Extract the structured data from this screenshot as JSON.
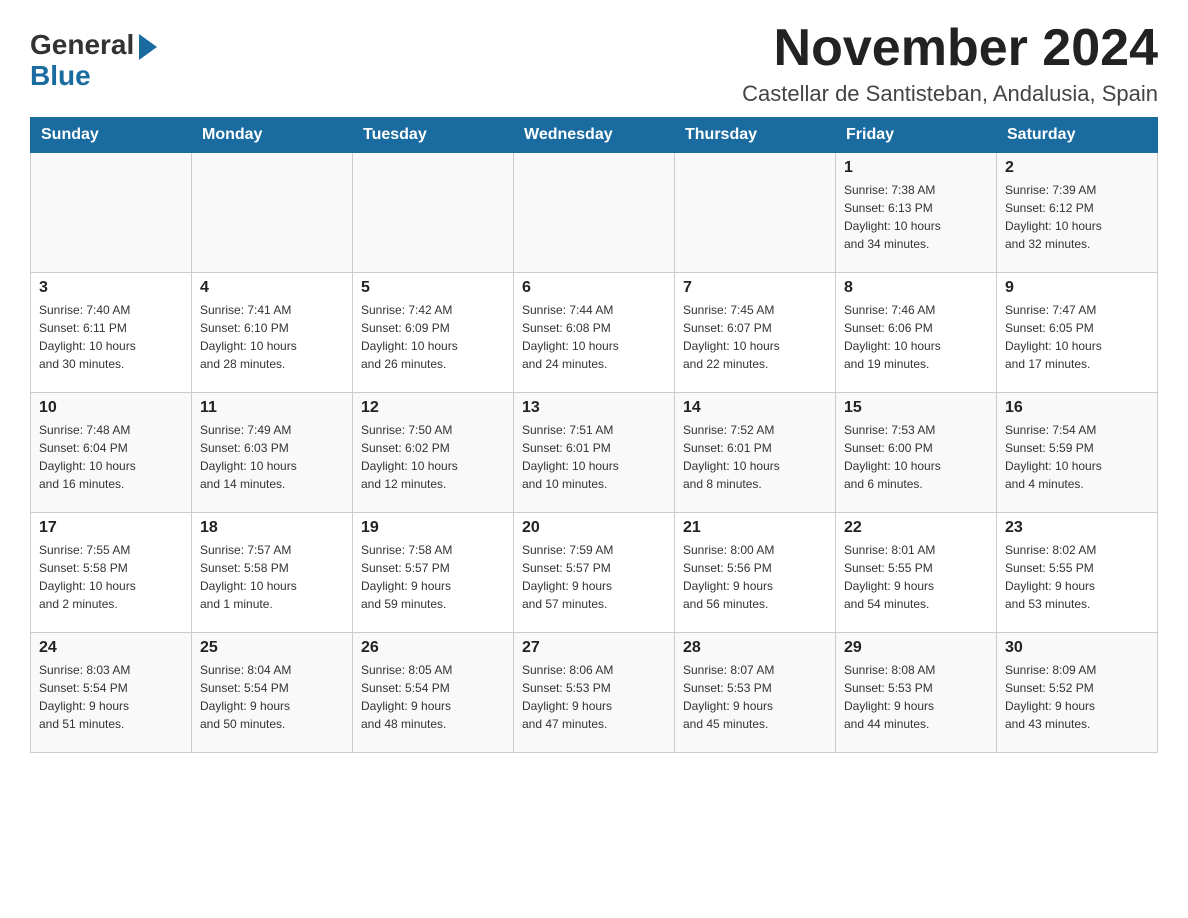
{
  "logo": {
    "general": "General",
    "blue": "Blue"
  },
  "header": {
    "month_year": "November 2024",
    "location": "Castellar de Santisteban, Andalusia, Spain"
  },
  "days_of_week": [
    "Sunday",
    "Monday",
    "Tuesday",
    "Wednesday",
    "Thursday",
    "Friday",
    "Saturday"
  ],
  "weeks": [
    [
      {
        "day": "",
        "info": ""
      },
      {
        "day": "",
        "info": ""
      },
      {
        "day": "",
        "info": ""
      },
      {
        "day": "",
        "info": ""
      },
      {
        "day": "",
        "info": ""
      },
      {
        "day": "1",
        "info": "Sunrise: 7:38 AM\nSunset: 6:13 PM\nDaylight: 10 hours\nand 34 minutes."
      },
      {
        "day": "2",
        "info": "Sunrise: 7:39 AM\nSunset: 6:12 PM\nDaylight: 10 hours\nand 32 minutes."
      }
    ],
    [
      {
        "day": "3",
        "info": "Sunrise: 7:40 AM\nSunset: 6:11 PM\nDaylight: 10 hours\nand 30 minutes."
      },
      {
        "day": "4",
        "info": "Sunrise: 7:41 AM\nSunset: 6:10 PM\nDaylight: 10 hours\nand 28 minutes."
      },
      {
        "day": "5",
        "info": "Sunrise: 7:42 AM\nSunset: 6:09 PM\nDaylight: 10 hours\nand 26 minutes."
      },
      {
        "day": "6",
        "info": "Sunrise: 7:44 AM\nSunset: 6:08 PM\nDaylight: 10 hours\nand 24 minutes."
      },
      {
        "day": "7",
        "info": "Sunrise: 7:45 AM\nSunset: 6:07 PM\nDaylight: 10 hours\nand 22 minutes."
      },
      {
        "day": "8",
        "info": "Sunrise: 7:46 AM\nSunset: 6:06 PM\nDaylight: 10 hours\nand 19 minutes."
      },
      {
        "day": "9",
        "info": "Sunrise: 7:47 AM\nSunset: 6:05 PM\nDaylight: 10 hours\nand 17 minutes."
      }
    ],
    [
      {
        "day": "10",
        "info": "Sunrise: 7:48 AM\nSunset: 6:04 PM\nDaylight: 10 hours\nand 16 minutes."
      },
      {
        "day": "11",
        "info": "Sunrise: 7:49 AM\nSunset: 6:03 PM\nDaylight: 10 hours\nand 14 minutes."
      },
      {
        "day": "12",
        "info": "Sunrise: 7:50 AM\nSunset: 6:02 PM\nDaylight: 10 hours\nand 12 minutes."
      },
      {
        "day": "13",
        "info": "Sunrise: 7:51 AM\nSunset: 6:01 PM\nDaylight: 10 hours\nand 10 minutes."
      },
      {
        "day": "14",
        "info": "Sunrise: 7:52 AM\nSunset: 6:01 PM\nDaylight: 10 hours\nand 8 minutes."
      },
      {
        "day": "15",
        "info": "Sunrise: 7:53 AM\nSunset: 6:00 PM\nDaylight: 10 hours\nand 6 minutes."
      },
      {
        "day": "16",
        "info": "Sunrise: 7:54 AM\nSunset: 5:59 PM\nDaylight: 10 hours\nand 4 minutes."
      }
    ],
    [
      {
        "day": "17",
        "info": "Sunrise: 7:55 AM\nSunset: 5:58 PM\nDaylight: 10 hours\nand 2 minutes."
      },
      {
        "day": "18",
        "info": "Sunrise: 7:57 AM\nSunset: 5:58 PM\nDaylight: 10 hours\nand 1 minute."
      },
      {
        "day": "19",
        "info": "Sunrise: 7:58 AM\nSunset: 5:57 PM\nDaylight: 9 hours\nand 59 minutes."
      },
      {
        "day": "20",
        "info": "Sunrise: 7:59 AM\nSunset: 5:57 PM\nDaylight: 9 hours\nand 57 minutes."
      },
      {
        "day": "21",
        "info": "Sunrise: 8:00 AM\nSunset: 5:56 PM\nDaylight: 9 hours\nand 56 minutes."
      },
      {
        "day": "22",
        "info": "Sunrise: 8:01 AM\nSunset: 5:55 PM\nDaylight: 9 hours\nand 54 minutes."
      },
      {
        "day": "23",
        "info": "Sunrise: 8:02 AM\nSunset: 5:55 PM\nDaylight: 9 hours\nand 53 minutes."
      }
    ],
    [
      {
        "day": "24",
        "info": "Sunrise: 8:03 AM\nSunset: 5:54 PM\nDaylight: 9 hours\nand 51 minutes."
      },
      {
        "day": "25",
        "info": "Sunrise: 8:04 AM\nSunset: 5:54 PM\nDaylight: 9 hours\nand 50 minutes."
      },
      {
        "day": "26",
        "info": "Sunrise: 8:05 AM\nSunset: 5:54 PM\nDaylight: 9 hours\nand 48 minutes."
      },
      {
        "day": "27",
        "info": "Sunrise: 8:06 AM\nSunset: 5:53 PM\nDaylight: 9 hours\nand 47 minutes."
      },
      {
        "day": "28",
        "info": "Sunrise: 8:07 AM\nSunset: 5:53 PM\nDaylight: 9 hours\nand 45 minutes."
      },
      {
        "day": "29",
        "info": "Sunrise: 8:08 AM\nSunset: 5:53 PM\nDaylight: 9 hours\nand 44 minutes."
      },
      {
        "day": "30",
        "info": "Sunrise: 8:09 AM\nSunset: 5:52 PM\nDaylight: 9 hours\nand 43 minutes."
      }
    ]
  ]
}
